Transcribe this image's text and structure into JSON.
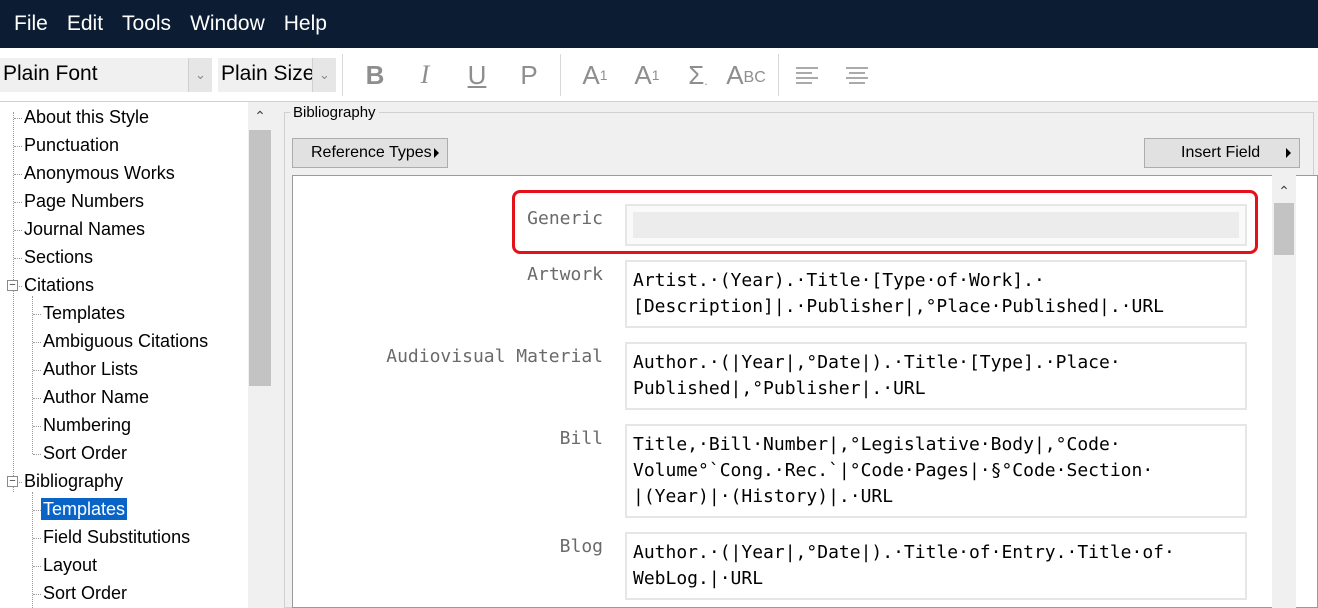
{
  "menu": [
    "File",
    "Edit",
    "Tools",
    "Window",
    "Help"
  ],
  "toolbar": {
    "font_value": "Plain Font",
    "size_value": "Plain Size",
    "bold": "B",
    "italic": "I",
    "underline": "U",
    "plain": "P",
    "superscript_base": "A",
    "superscript_mark": "1",
    "subscript_base": "A",
    "subscript_mark": "1",
    "symbol": "Σ",
    "small_caps_big": "A",
    "small_caps_small": "BC"
  },
  "tree": {
    "items": [
      {
        "label": "About this Style",
        "level": 1
      },
      {
        "label": "Punctuation",
        "level": 1
      },
      {
        "label": "Anonymous Works",
        "level": 1
      },
      {
        "label": "Page Numbers",
        "level": 1
      },
      {
        "label": "Journal Names",
        "level": 1
      },
      {
        "label": "Sections",
        "level": 1
      },
      {
        "label": "Citations",
        "level": 1,
        "expander": "−"
      },
      {
        "label": "Templates",
        "level": 2
      },
      {
        "label": "Ambiguous Citations",
        "level": 2
      },
      {
        "label": "Author Lists",
        "level": 2
      },
      {
        "label": "Author Name",
        "level": 2
      },
      {
        "label": "Numbering",
        "level": 2
      },
      {
        "label": "Sort Order",
        "level": 2
      },
      {
        "label": "Bibliography",
        "level": 1,
        "expander": "−"
      },
      {
        "label": "Templates",
        "level": 2,
        "selected": true
      },
      {
        "label": "Field Substitutions",
        "level": 2
      },
      {
        "label": "Layout",
        "level": 2
      },
      {
        "label": "Sort Order",
        "level": 2
      }
    ]
  },
  "panel": {
    "group_title": "Bibliography",
    "reference_types_button": "Reference Types",
    "insert_field_button": "Insert Field"
  },
  "templates": [
    {
      "name": "Generic",
      "lines": []
    },
    {
      "name": "Artwork",
      "lines": [
        "Artist.·(Year).·Title·[Type·of·Work].·",
        "[Description]|.·Publisher|,°Place·Published|.·URL"
      ]
    },
    {
      "name": "Audiovisual Material",
      "lines": [
        "Author.·(|Year|,°Date|).·Title·[Type].·Place·",
        "Published|,°Publisher|.·URL"
      ]
    },
    {
      "name": "Bill",
      "lines": [
        "Title,·Bill·Number|,°Legislative·Body|,°Code·",
        "Volume°`Cong.·Rec.`|°Code·Pages|·§°Code·Section·",
        "|(Year)|·(History)|.·URL"
      ]
    },
    {
      "name": "Blog",
      "lines": [
        "Author.·(|Year|,°Date|).·Title·of·Entry.·Title·of·",
        "WebLog.|·URL"
      ]
    }
  ],
  "colors": {
    "menubar_bg": "#0b1c33",
    "selection_bg": "#0a64c8",
    "highlight_border": "#e4101a"
  }
}
